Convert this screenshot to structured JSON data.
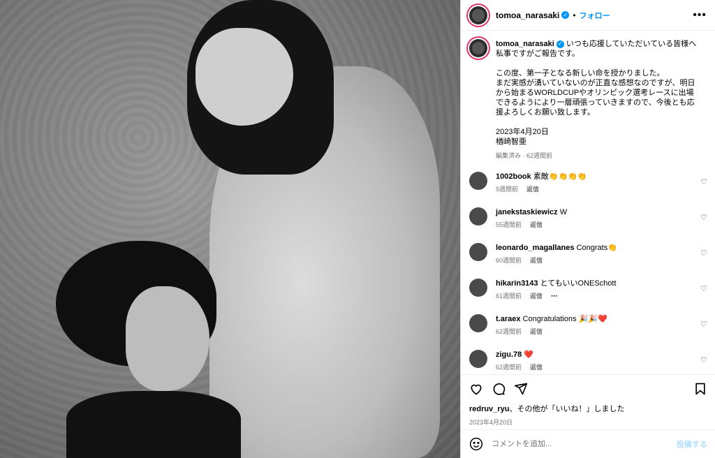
{
  "post": {
    "username": "tomoa_narasaki",
    "follow_label": "フォロー",
    "dot": "•",
    "more_icon": "more-icon"
  },
  "caption": {
    "username": "tomoa_narasaki",
    "text": "いつも応援していただいている皆様へ\n私事ですがご報告です。\n\nこの度、第一子となる新しい命を授かりました。\nまだ実感が湧いていないのが正直な感想なのですが、明日から始まるWORLDCUPやオリンピック選考レースに出場できるようにより一層頑張っていきますので、今後とも応援よろしくお願い致します。\n\n2023年4月20日\n楢崎智亜",
    "meta": "編集済み · 62週間前"
  },
  "comments": [
    {
      "username": "1002book",
      "text": "素敵👏👏👏👏",
      "time": "9週間前",
      "reply": "返信"
    },
    {
      "username": "janekstaskiewicz",
      "text": "W",
      "time": "55週間前",
      "reply": "返信"
    },
    {
      "username": "leonardo_magallanes",
      "text": "Congrats👏",
      "time": "60週間前",
      "reply": "返信"
    },
    {
      "username": "hikarin3143",
      "text": "とてもいいONESchott",
      "time": "61週間前",
      "reply": "返信",
      "extra": "•••"
    },
    {
      "username": "t.araex",
      "text": "Congratulations 🎉🎉❤️",
      "time": "62週間前",
      "reply": "返信"
    },
    {
      "username": "zigu.78",
      "text": "❤️",
      "time": "62週間前",
      "reply": "返信"
    }
  ],
  "actions": {
    "likes_user": "redruv_ryu",
    "likes_suffix": "、その他が「いいね！」しました",
    "date": "2023年4月20日"
  },
  "comment_bar": {
    "placeholder": "コメントを追加...",
    "post_label": "投稿する"
  },
  "colors": {
    "accent": "#0095f6",
    "post_disabled": "#b2dffc",
    "heart": "#ed4956"
  },
  "icons": [
    "heart-icon",
    "comment-icon",
    "share-icon",
    "bookmark-icon",
    "emoji-icon"
  ]
}
